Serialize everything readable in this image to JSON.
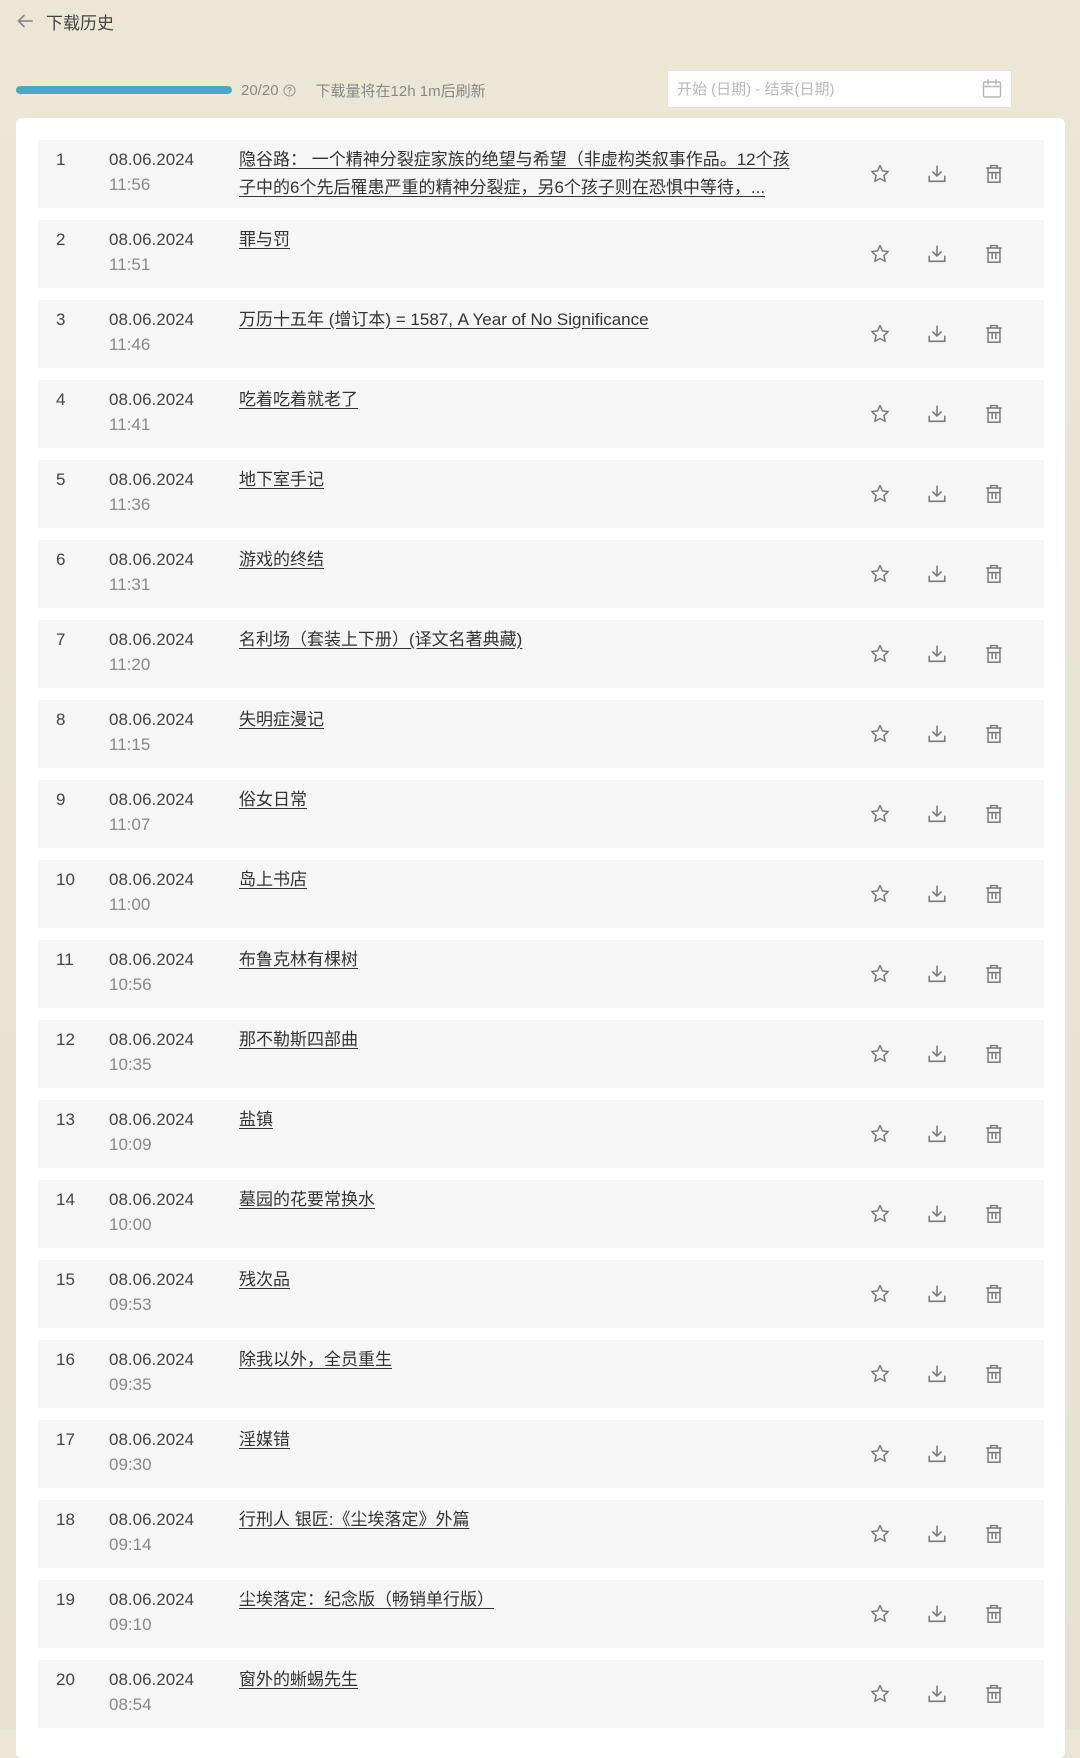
{
  "header": {
    "back_icon": "arrow-left-icon",
    "title": "下载历史"
  },
  "quota": {
    "progress_percent": 100,
    "count_text": "20/20",
    "help_icon": "question-circle-icon",
    "refresh_text": "下载量将在12h 1m后刷新",
    "progress_color": "#4aa9c4"
  },
  "date_filter": {
    "placeholder": "开始 (日期) - 结束(日期)",
    "value": "",
    "icon": "calendar-icon"
  },
  "row_actions": {
    "favorite_icon": "star-icon",
    "download_icon": "download-icon",
    "delete_icon": "trash-icon"
  },
  "downloads": [
    {
      "index": "1",
      "date": "08.06.2024",
      "time": "11:56",
      "title": "隐谷路： 一个精神分裂症家族的绝望与希望（非虚构类叙事作品。12个孩子中的6个先后罹患严重的精神分裂症，另6个孩子则在恐惧中等待，..."
    },
    {
      "index": "2",
      "date": "08.06.2024",
      "time": "11:51",
      "title": "罪与罚"
    },
    {
      "index": "3",
      "date": "08.06.2024",
      "time": "11:46",
      "title": "万历十五年 (增订本) = 1587, A Year of No Significance"
    },
    {
      "index": "4",
      "date": "08.06.2024",
      "time": "11:41",
      "title": "吃着吃着就老了"
    },
    {
      "index": "5",
      "date": "08.06.2024",
      "time": "11:36",
      "title": "地下室手记"
    },
    {
      "index": "6",
      "date": "08.06.2024",
      "time": "11:31",
      "title": "游戏的终结"
    },
    {
      "index": "7",
      "date": "08.06.2024",
      "time": "11:20",
      "title": "名利场（套装上下册）(译文名著典藏)"
    },
    {
      "index": "8",
      "date": "08.06.2024",
      "time": "11:15",
      "title": "失明症漫记"
    },
    {
      "index": "9",
      "date": "08.06.2024",
      "time": "11:07",
      "title": "俗女日常"
    },
    {
      "index": "10",
      "date": "08.06.2024",
      "time": "11:00",
      "title": "岛上书店"
    },
    {
      "index": "11",
      "date": "08.06.2024",
      "time": "10:56",
      "title": "布鲁克林有棵树"
    },
    {
      "index": "12",
      "date": "08.06.2024",
      "time": "10:35",
      "title": "那不勒斯四部曲"
    },
    {
      "index": "13",
      "date": "08.06.2024",
      "time": "10:09",
      "title": "盐镇"
    },
    {
      "index": "14",
      "date": "08.06.2024",
      "time": "10:00",
      "title": "墓园的花要常换水"
    },
    {
      "index": "15",
      "date": "08.06.2024",
      "time": "09:53",
      "title": "残次品"
    },
    {
      "index": "16",
      "date": "08.06.2024",
      "time": "09:35",
      "title": "除我以外，全员重生"
    },
    {
      "index": "17",
      "date": "08.06.2024",
      "time": "09:30",
      "title": "淫媒错"
    },
    {
      "index": "18",
      "date": "08.06.2024",
      "time": "09:14",
      "title": "行刑人 银匠:《尘埃落定》外篇"
    },
    {
      "index": "19",
      "date": "08.06.2024",
      "time": "09:10",
      "title": "尘埃落定：纪念版（畅销单行版）"
    },
    {
      "index": "20",
      "date": "08.06.2024",
      "time": "08:54",
      "title": "窗外的蜥蜴先生"
    }
  ]
}
